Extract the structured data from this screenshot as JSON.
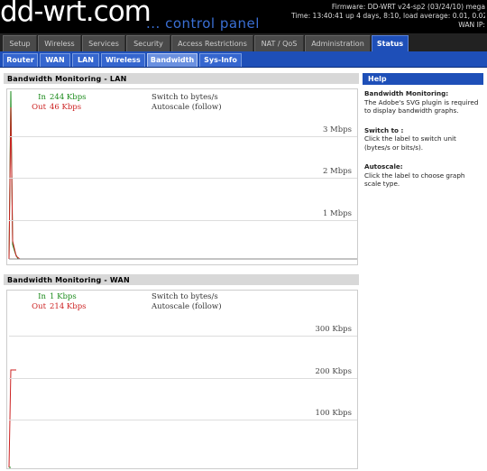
{
  "header": {
    "logo_main": "dd-wrt",
    "logo_dot": ".com",
    "subtitle": "... control panel",
    "firmware": "Firmware: DD-WRT v24-sp2 (03/24/10) mega",
    "time": "Time: 13:40:41 up 4 days, 8:10, load average: 0.01, 0.02, 0.00",
    "wan_ip": "WAN IP:"
  },
  "tabs": [
    {
      "label": "Setup",
      "active": false
    },
    {
      "label": "Wireless",
      "active": false
    },
    {
      "label": "Services",
      "active": false
    },
    {
      "label": "Security",
      "active": false
    },
    {
      "label": "Access Restrictions",
      "active": false
    },
    {
      "label": "NAT / QoS",
      "active": false
    },
    {
      "label": "Administration",
      "active": false
    },
    {
      "label": "Status",
      "active": true
    }
  ],
  "subtabs": [
    {
      "label": "Router",
      "active": false
    },
    {
      "label": "WAN",
      "active": false
    },
    {
      "label": "LAN",
      "active": false
    },
    {
      "label": "Wireless",
      "active": false
    },
    {
      "label": "Bandwidth",
      "active": true
    },
    {
      "label": "Sys-Info",
      "active": false
    }
  ],
  "lan": {
    "title": "Bandwidth Monitoring - LAN",
    "in_label": "In",
    "in_value": "244 Kbps",
    "out_label": "Out",
    "out_value": "46 Kbps",
    "switch_label": "Switch to bytes/s",
    "autoscale_label": "Autoscale (follow)",
    "grid_labels": [
      "3 Mbps",
      "2 Mbps",
      "1 Mbps"
    ],
    "in_color": "#1a8a1a",
    "out_color": "#cc2222"
  },
  "wan": {
    "title": "Bandwidth Monitoring - WAN",
    "in_label": "In",
    "in_value": "1 Kbps",
    "out_label": "Out",
    "out_value": "214 Kbps",
    "switch_label": "Switch to bytes/s",
    "autoscale_label": "Autoscale (follow)",
    "grid_labels": [
      "300 Kbps",
      "200 Kbps",
      "100 Kbps"
    ],
    "in_color": "#1a8a1a",
    "out_color": "#cc2222"
  },
  "help": {
    "title": "Help",
    "sections": [
      {
        "heading": "Bandwidth Monitoring:",
        "text": "The Adobe's SVG plugin is required to display bandwidth graphs."
      },
      {
        "heading": "Switch to :",
        "text": "Click the label to switch unit (bytes/s or bits/s)."
      },
      {
        "heading": "Autoscale:",
        "text": "Click the label to choose graph scale type."
      }
    ]
  },
  "colors": {
    "accent": "#1e4fb8",
    "header_bg": "#000000",
    "tab_bg": "#4a4a4a"
  }
}
